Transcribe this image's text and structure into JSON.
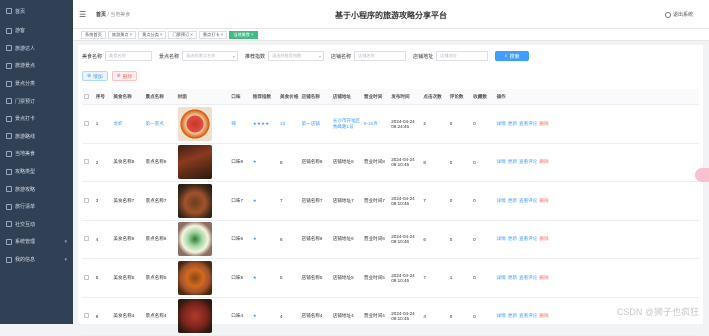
{
  "sidebar": {
    "items": [
      {
        "label": "首页"
      },
      {
        "label": "游客"
      },
      {
        "label": "旅游达人"
      },
      {
        "label": "旅游景点"
      },
      {
        "label": "景点分类"
      },
      {
        "label": "门票预订"
      },
      {
        "label": "景点打卡"
      },
      {
        "label": "旅游路线"
      },
      {
        "label": "当地美食"
      },
      {
        "label": "攻略类型"
      },
      {
        "label": "旅游攻略"
      },
      {
        "label": "旅行清单"
      },
      {
        "label": "社交互动"
      },
      {
        "label": "系统管理",
        "chev": "▾"
      },
      {
        "label": "我的信息",
        "chev": "▾"
      }
    ]
  },
  "header": {
    "breadcrumb_home": "首页",
    "breadcrumb_sep": "/",
    "breadcrumb_current": "当地美食",
    "title": "基于小程序的旅游攻略分享平台",
    "logout": "退出系统"
  },
  "tabs": [
    {
      "label": "系统首页"
    },
    {
      "label": "旅游景点 ×"
    },
    {
      "label": "景点分类 ×"
    },
    {
      "label": "门票预订 ×"
    },
    {
      "label": "景点打卡 ×"
    },
    {
      "label": "当地美食 ×",
      "active": true
    }
  ],
  "filters": {
    "food_name_label": "美食名称",
    "food_name_placeholder": "美食名称",
    "spot_name_label": "景点名称",
    "spot_name_placeholder": "请选择景点名称",
    "recommend_label": "推荐指数",
    "recommend_placeholder": "请选择推荐指数",
    "shop_name_label": "店铺名称",
    "shop_name_placeholder": "店铺名称",
    "shop_addr_label": "店铺地址",
    "shop_addr_placeholder": "店铺地址",
    "search_label": "搜索"
  },
  "actions": {
    "add_label": "增加",
    "delete_label": "删除"
  },
  "table": {
    "headers": [
      "序号",
      "美食名称",
      "景点名称",
      "封面",
      "口味",
      "推荐指数",
      "美食价格",
      "店铺名称",
      "店铺地址",
      "营业时间",
      "发布时间",
      "点击次数",
      "评论数",
      "收藏数",
      "操作"
    ],
    "rows": [
      {
        "idx": "1",
        "food": "龙虾",
        "spot": "第一景点",
        "taste": "辣",
        "stars": "★★★★",
        "price": "33",
        "shop": "第一店铺",
        "addr": "长沙市开福区秀峰路1号",
        "hours": "8-15点",
        "time": "2024-04-24 09:24:45",
        "clicks": "2",
        "comments": "0",
        "favs": "0"
      },
      {
        "idx": "2",
        "food": "美食名称8",
        "spot": "景点名称8",
        "taste": "口味8",
        "stars": "★",
        "price": "8",
        "shop": "店铺名称8",
        "addr": "店铺地址8",
        "hours": "营业时间8",
        "time": "2024-04-24 09:10:45",
        "clicks": "8",
        "comments": "0",
        "favs": "0"
      },
      {
        "idx": "3",
        "food": "美食名称7",
        "spot": "景点名称7",
        "taste": "口味7",
        "stars": "★",
        "price": "7",
        "shop": "店铺名称7",
        "addr": "店铺地址7",
        "hours": "营业时间7",
        "time": "2024-04-24 09:10:45",
        "clicks": "7",
        "comments": "0",
        "favs": "0"
      },
      {
        "idx": "4",
        "food": "美食名称6",
        "spot": "景点名称6",
        "taste": "口味6",
        "stars": "★",
        "price": "6",
        "shop": "店铺名称6",
        "addr": "店铺地址6",
        "hours": "营业时间6",
        "time": "2024-04-24 09:10:45",
        "clicks": "6",
        "comments": "0",
        "favs": "0"
      },
      {
        "idx": "5",
        "food": "美食名称5",
        "spot": "景点名称5",
        "taste": "口味5",
        "stars": "★",
        "price": "5",
        "shop": "店铺名称5",
        "addr": "店铺地址5",
        "hours": "营业时间5",
        "time": "2024-04-24 09:10:45",
        "clicks": "7",
        "comments": "1",
        "favs": "0"
      },
      {
        "idx": "6",
        "food": "美食名称4",
        "spot": "景点名称4",
        "taste": "口味4",
        "stars": "★",
        "price": "4",
        "shop": "店铺名称4",
        "addr": "店铺地址4",
        "hours": "营业时间4",
        "time": "2024-04-24 09:10:45",
        "clicks": "4",
        "comments": "0",
        "favs": "0"
      }
    ],
    "ops": {
      "detail": "详情",
      "edit": "更新",
      "review": "查看评论",
      "delete": "删除"
    }
  },
  "colors": {
    "sidebar_bg": "#304156",
    "primary": "#409eff",
    "danger": "#f56c6c",
    "active_tab": "#42b983"
  },
  "watermark": "CSDN @狮子也疯狂"
}
